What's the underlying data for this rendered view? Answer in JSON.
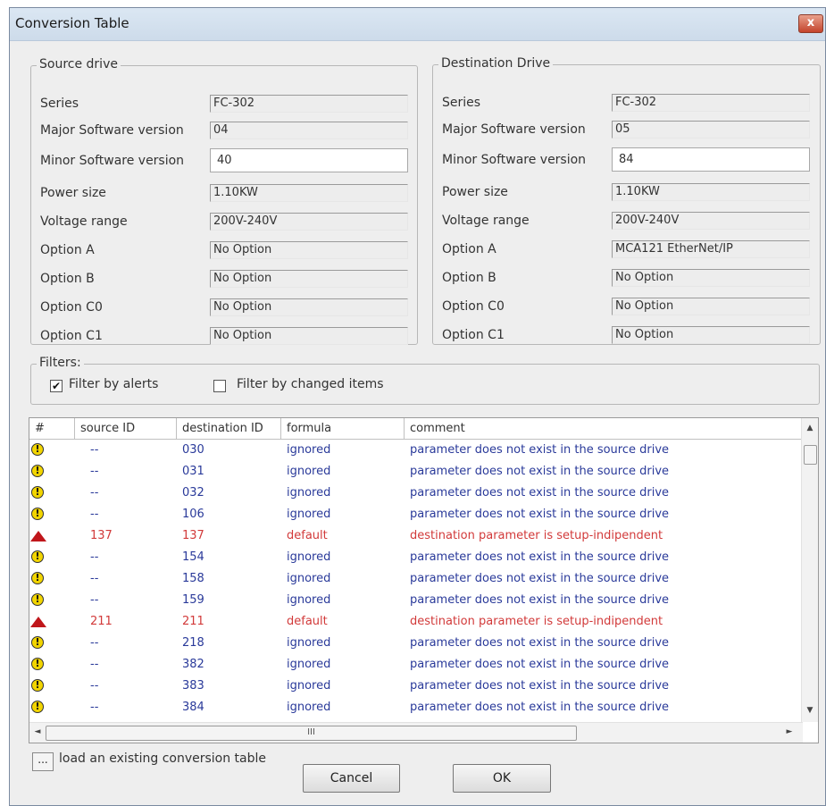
{
  "window": {
    "title": "Conversion Table",
    "close_label": "x"
  },
  "source": {
    "legend": "Source drive",
    "rows": [
      {
        "label": "Series",
        "value": "FC-302"
      },
      {
        "label": "Major Software version",
        "value": "04"
      },
      {
        "label": "Minor Software version",
        "value": "40"
      },
      {
        "label": "Power size",
        "value": "1.10KW"
      },
      {
        "label": "Voltage range",
        "value": "200V-240V"
      },
      {
        "label": "Option A",
        "value": "No Option"
      },
      {
        "label": "Option B",
        "value": "No Option"
      },
      {
        "label": "Option C0",
        "value": "No Option"
      },
      {
        "label": "Option C1",
        "value": "No Option"
      }
    ]
  },
  "destination": {
    "legend": "Destination Drive",
    "rows": [
      {
        "label": "Series",
        "value": "FC-302"
      },
      {
        "label": "Major Software version",
        "value": "05"
      },
      {
        "label": "Minor Software version",
        "value": "84"
      },
      {
        "label": "Power size",
        "value": "1.10KW"
      },
      {
        "label": "Voltage range",
        "value": "200V-240V"
      },
      {
        "label": "Option A",
        "value": "MCA121 EtherNet/IP"
      },
      {
        "label": "Option B",
        "value": "No Option"
      },
      {
        "label": "Option C0",
        "value": "No Option"
      },
      {
        "label": "Option C1",
        "value": "No Option"
      }
    ]
  },
  "filters": {
    "legend": "Filters:",
    "alerts_label": "Filter by alerts",
    "alerts_checked": true,
    "changed_label": "Filter by changed items",
    "changed_checked": false
  },
  "table": {
    "columns": [
      "#",
      "source ID",
      "destination ID",
      "formula",
      "comment"
    ],
    "rows": [
      {
        "icon": "warning-icon",
        "source": "--",
        "dest": "030",
        "formula": "ignored",
        "comment": "parameter does not exist in the source drive",
        "color": "#2a3a9a"
      },
      {
        "icon": "warning-icon",
        "source": "--",
        "dest": "031",
        "formula": "ignored",
        "comment": "parameter does not exist in the source drive",
        "color": "#2a3a9a"
      },
      {
        "icon": "warning-icon",
        "source": "--",
        "dest": "032",
        "formula": "ignored",
        "comment": "parameter does not exist in the source drive",
        "color": "#2a3a9a"
      },
      {
        "icon": "warning-icon",
        "source": "--",
        "dest": "106",
        "formula": "ignored",
        "comment": "parameter does not exist in the source drive",
        "color": "#2a3a9a"
      },
      {
        "icon": "alert-icon",
        "source": "137",
        "dest": "137",
        "formula": "default",
        "comment": "destination parameter is setup-indipendent",
        "color": "#d23a3a"
      },
      {
        "icon": "warning-icon",
        "source": "--",
        "dest": "154",
        "formula": "ignored",
        "comment": "parameter does not exist in the source drive",
        "color": "#2a3a9a"
      },
      {
        "icon": "warning-icon",
        "source": "--",
        "dest": "158",
        "formula": "ignored",
        "comment": "parameter does not exist in the source drive",
        "color": "#2a3a9a"
      },
      {
        "icon": "warning-icon",
        "source": "--",
        "dest": "159",
        "formula": "ignored",
        "comment": "parameter does not exist in the source drive",
        "color": "#2a3a9a"
      },
      {
        "icon": "alert-icon",
        "source": "211",
        "dest": "211",
        "formula": "default",
        "comment": "destination parameter is setup-indipendent",
        "color": "#d23a3a"
      },
      {
        "icon": "warning-icon",
        "source": "--",
        "dest": "218",
        "formula": "ignored",
        "comment": "parameter does not exist in the source drive",
        "color": "#2a3a9a"
      },
      {
        "icon": "warning-icon",
        "source": "--",
        "dest": "382",
        "formula": "ignored",
        "comment": "parameter does not exist in the source drive",
        "color": "#2a3a9a"
      },
      {
        "icon": "warning-icon",
        "source": "--",
        "dest": "383",
        "formula": "ignored",
        "comment": "parameter does not exist in the source drive",
        "color": "#2a3a9a"
      },
      {
        "icon": "warning-icon",
        "source": "--",
        "dest": "384",
        "formula": "ignored",
        "comment": "parameter does not exist in the source drive",
        "color": "#2a3a9a"
      }
    ],
    "hscroll_thumb_label": "III"
  },
  "footer": {
    "browse_label": "...",
    "load_label": "load an existing conversion table",
    "cancel_label": "Cancel",
    "ok_label": "OK"
  }
}
